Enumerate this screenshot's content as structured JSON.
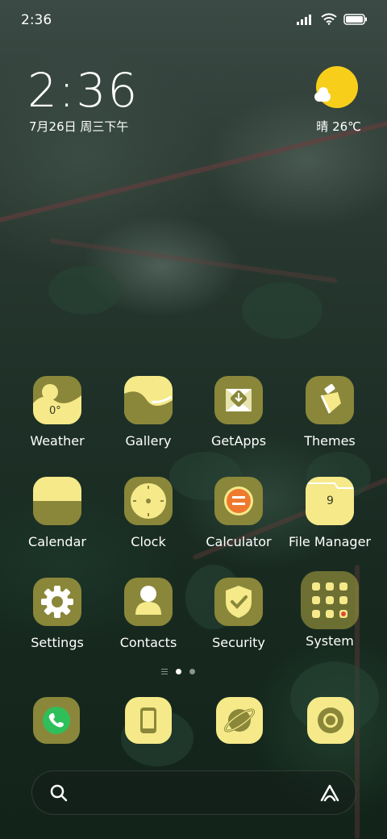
{
  "status_bar": {
    "time": "2:36"
  },
  "clock_widget": {
    "time": "2:36",
    "date": "7月26日 周三下午"
  },
  "weather_widget": {
    "summary": "晴 26℃"
  },
  "apps": [
    {
      "label": "Weather",
      "icon": "weather-icon",
      "badge": "0°"
    },
    {
      "label": "Gallery",
      "icon": "gallery-icon"
    },
    {
      "label": "GetApps",
      "icon": "getapps-icon"
    },
    {
      "label": "Themes",
      "icon": "themes-icon"
    },
    {
      "label": "Calendar",
      "icon": "calendar-icon"
    },
    {
      "label": "Clock",
      "icon": "clock-icon"
    },
    {
      "label": "Calculator",
      "icon": "calculator-icon"
    },
    {
      "label": "File Manager",
      "icon": "file-manager-icon",
      "badge": "9"
    },
    {
      "label": "Settings",
      "icon": "settings-gear-icon"
    },
    {
      "label": "Contacts",
      "icon": "contacts-icon"
    },
    {
      "label": "Security",
      "icon": "security-shield-icon"
    },
    {
      "label": "System",
      "icon": "system-folder-icon"
    }
  ],
  "dock": [
    {
      "icon": "phone-icon"
    },
    {
      "icon": "messages-icon"
    },
    {
      "icon": "browser-icon"
    },
    {
      "icon": "camera-icon"
    }
  ],
  "page_indicator": {
    "pages": 2,
    "current": 1
  },
  "colors": {
    "icon_olive": "#8a873a",
    "icon_yellow": "#f5e98a",
    "sun": "#f7cf1a",
    "phone_green": "#2fbf5a",
    "calculator_orange": "#ef7a2f"
  }
}
